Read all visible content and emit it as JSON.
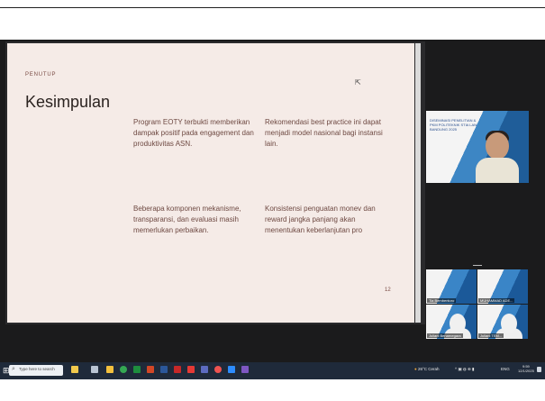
{
  "slide": {
    "label": "PENUTUP",
    "title": "Kesimpulan",
    "points": [
      "Program EOTY terbukti memberikan dampak positif pada engagement dan produktivitas ASN.",
      "Rekomendasi best practice ini dapat menjadi model nasional bagi instansi lain.",
      "Beberapa komponen mekanisme, transparansi, dan evaluasi masih memerlukan perbaikan.",
      "Konsistensi penguatan monev dan reward jangka panjang akan menentukan keberlanjutan pro"
    ],
    "page_number": "12"
  },
  "video": {
    "main_caption": "DISEMINASI PENELITIAN & PKM POLITEKNIK STIA LAN BANDUNG 2025",
    "tiles": [
      {
        "name": "Tia Bembentoro"
      },
      {
        "name": "MUHAMMAD ADE..."
      },
      {
        "name": "Juliani Benarnegara"
      },
      {
        "name": "Juliani TEM..."
      }
    ]
  },
  "taskbar": {
    "search_placeholder": "Type here to search",
    "weather": "26°C Cerah",
    "language": "ENG",
    "time": "9:59",
    "date": "12/1/2025"
  },
  "colors": {
    "slide_bg": "#f5ebe7",
    "meeting_bg": "#1b1b1c",
    "taskbar_bg": "#1f2a3a"
  }
}
